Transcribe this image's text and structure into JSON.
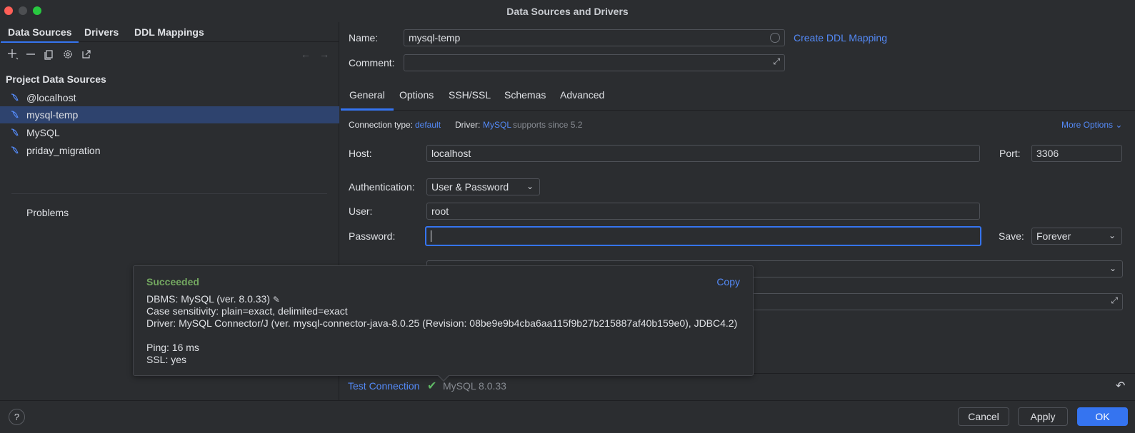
{
  "window": {
    "title": "Data Sources and Drivers"
  },
  "left": {
    "tabs": [
      "Data Sources",
      "Drivers",
      "DDL Mappings"
    ],
    "section_title": "Project Data Sources",
    "items": [
      "@localhost",
      "mysql-temp",
      "MySQL",
      "priday_migration"
    ],
    "selected_item": "mysql-temp",
    "problems": "Problems"
  },
  "right": {
    "name_label": "Name:",
    "name_value": "mysql-temp",
    "create_ddl": "Create DDL Mapping",
    "comment_label": "Comment:",
    "comment_value": "",
    "tabs": [
      "General",
      "Options",
      "SSH/SSL",
      "Schemas",
      "Advanced"
    ],
    "active_tab": "General",
    "conn_type_label": "Connection type:",
    "conn_type_value": "default",
    "driver_label": "Driver:",
    "driver_value": "MySQL",
    "driver_note": "supports since 5.2",
    "more_options": "More Options",
    "host_label": "Host:",
    "host_value": "localhost",
    "port_label": "Port:",
    "port_value": "3306",
    "auth_label": "Authentication:",
    "auth_value": "User & Password",
    "user_label": "User:",
    "user_value": "root",
    "password_label": "Password:",
    "password_value": "",
    "save_label": "Save:",
    "save_value": "Forever",
    "test_connection": "Test Connection",
    "test_result": "MySQL 8.0.33"
  },
  "popup": {
    "status": "Succeeded",
    "copy": "Copy",
    "dbms": "DBMS: MySQL (ver. 8.0.33)",
    "case": "Case sensitivity: plain=exact, delimited=exact",
    "driver": "Driver: MySQL Connector/J (ver. mysql-connector-java-8.0.25 (Revision: 08be9e9b4cba6aa115f9b27b215887af40b159e0), JDBC4.2)",
    "ping": "Ping: 16 ms",
    "ssl": "SSL: yes"
  },
  "footer": {
    "help": "?",
    "cancel": "Cancel",
    "apply": "Apply",
    "ok": "OK"
  },
  "colors": {
    "accent": "#3574f0",
    "selection": "#2e436e",
    "success": "#73a760",
    "link": "#548af7"
  }
}
